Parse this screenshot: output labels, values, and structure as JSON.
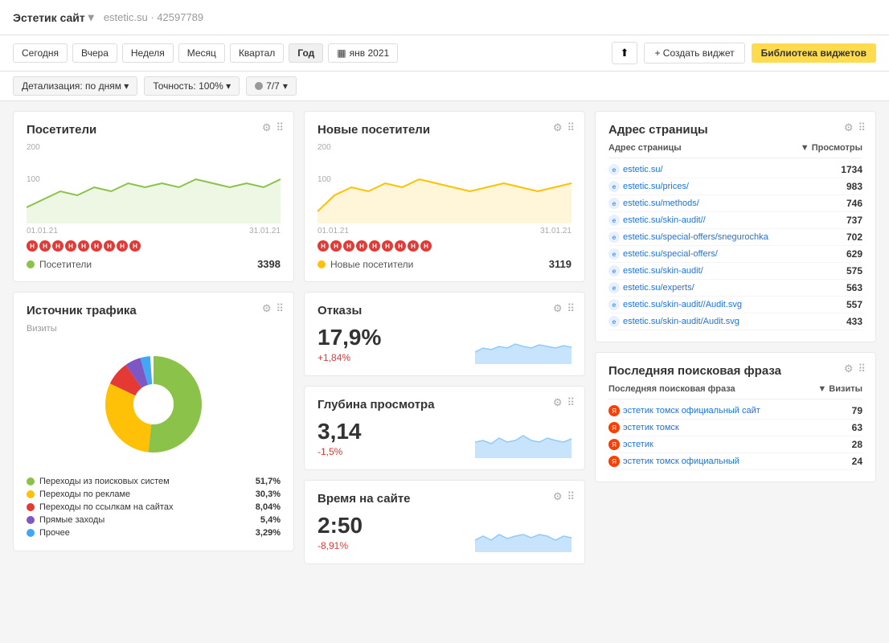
{
  "header": {
    "site_name": "Эстетик сайт",
    "site_url": "estetic.su",
    "site_id": "42597789",
    "chevron": "▾"
  },
  "toolbar": {
    "periods": [
      "Сегодня",
      "Вчера",
      "Неделя",
      "Месяц",
      "Квартал",
      "Год"
    ],
    "active_period": "Год",
    "date_icon": "▦",
    "date_label": "янв 2021",
    "export_icon": "⬆",
    "create_label": "+ Создать виджет",
    "library_label": "Библиотека виджетов"
  },
  "subtoolbar": {
    "detail_label": "Детализация: по дням",
    "accuracy_label": "Точность: 100%",
    "counter_label": "7/7"
  },
  "visitors_widget": {
    "title": "Посетители",
    "y200": "200",
    "y100": "100",
    "date_start": "01.01.21",
    "date_end": "31.01.21",
    "legend_label": "Посетители",
    "legend_value": "3398"
  },
  "new_visitors_widget": {
    "title": "Новые посетители",
    "y200": "200",
    "y100": "100",
    "date_start": "01.01.21",
    "date_end": "31.01.21",
    "legend_label": "Новые посетители",
    "legend_value": "3119"
  },
  "traffic_source_widget": {
    "title": "Источник трафика",
    "subtitle": "Визиты",
    "legend": [
      {
        "label": "Переходы из поисковых систем",
        "value": "51,7%",
        "color": "#8bc34a"
      },
      {
        "label": "Переходы по рекламе",
        "value": "30,3%",
        "color": "#ffc107"
      },
      {
        "label": "Переходы по ссылкам на сайтах",
        "value": "8,04%",
        "color": "#e53935"
      },
      {
        "label": "Прямые заходы",
        "value": "5,4%",
        "color": "#7e57c2"
      },
      {
        "label": "Прочее",
        "value": "3,29%",
        "color": "#42a5f5"
      }
    ]
  },
  "bounce_widget": {
    "title": "Отказы",
    "value": "17,9%",
    "change": "+1,84%",
    "change_type": "positive"
  },
  "depth_widget": {
    "title": "Глубина просмотра",
    "value": "3,14",
    "change": "-1,5%",
    "change_type": "negative"
  },
  "time_widget": {
    "title": "Время на сайте",
    "value": "2:50",
    "change": "-8,91%",
    "change_type": "negative"
  },
  "address_widget": {
    "title": "Адрес страницы",
    "col1": "Адрес страницы",
    "col2": "▼ Просмотры",
    "rows": [
      {
        "url": "estetic.su/",
        "count": "1734"
      },
      {
        "url": "estetic.su/prices/",
        "count": "983"
      },
      {
        "url": "estetic.su/methods/",
        "count": "746"
      },
      {
        "url": "estetic.su/skin-audit//",
        "count": "737"
      },
      {
        "url": "estetic.su/special-offers/snegurochka...",
        "count": "702"
      },
      {
        "url": "estetic.su/special-offers/",
        "count": "629"
      },
      {
        "url": "estetic.su/skin-audit/",
        "count": "575"
      },
      {
        "url": "estetic.su/experts/",
        "count": "563"
      },
      {
        "url": "estetic.su/skin-audit//Audit.svg",
        "count": "557"
      },
      {
        "url": "estetic.su/skin-audit/Audit.svg",
        "count": "433"
      }
    ]
  },
  "search_phrase_widget": {
    "title": "Последняя поисковая фраза",
    "col1": "Последняя поисковая фраза",
    "col2": "▼ Визиты",
    "rows": [
      {
        "phrase": "эстетик томск официальный сайт",
        "count": "79"
      },
      {
        "phrase": "эстетик томск",
        "count": "63"
      },
      {
        "phrase": "эстетик",
        "count": "28"
      },
      {
        "phrase": "эстетик томск официальный",
        "count": "24"
      }
    ]
  },
  "icons": {
    "gear": "⚙",
    "grid": "⠿",
    "chevron_down": "▾",
    "ellipsis": "Н"
  }
}
